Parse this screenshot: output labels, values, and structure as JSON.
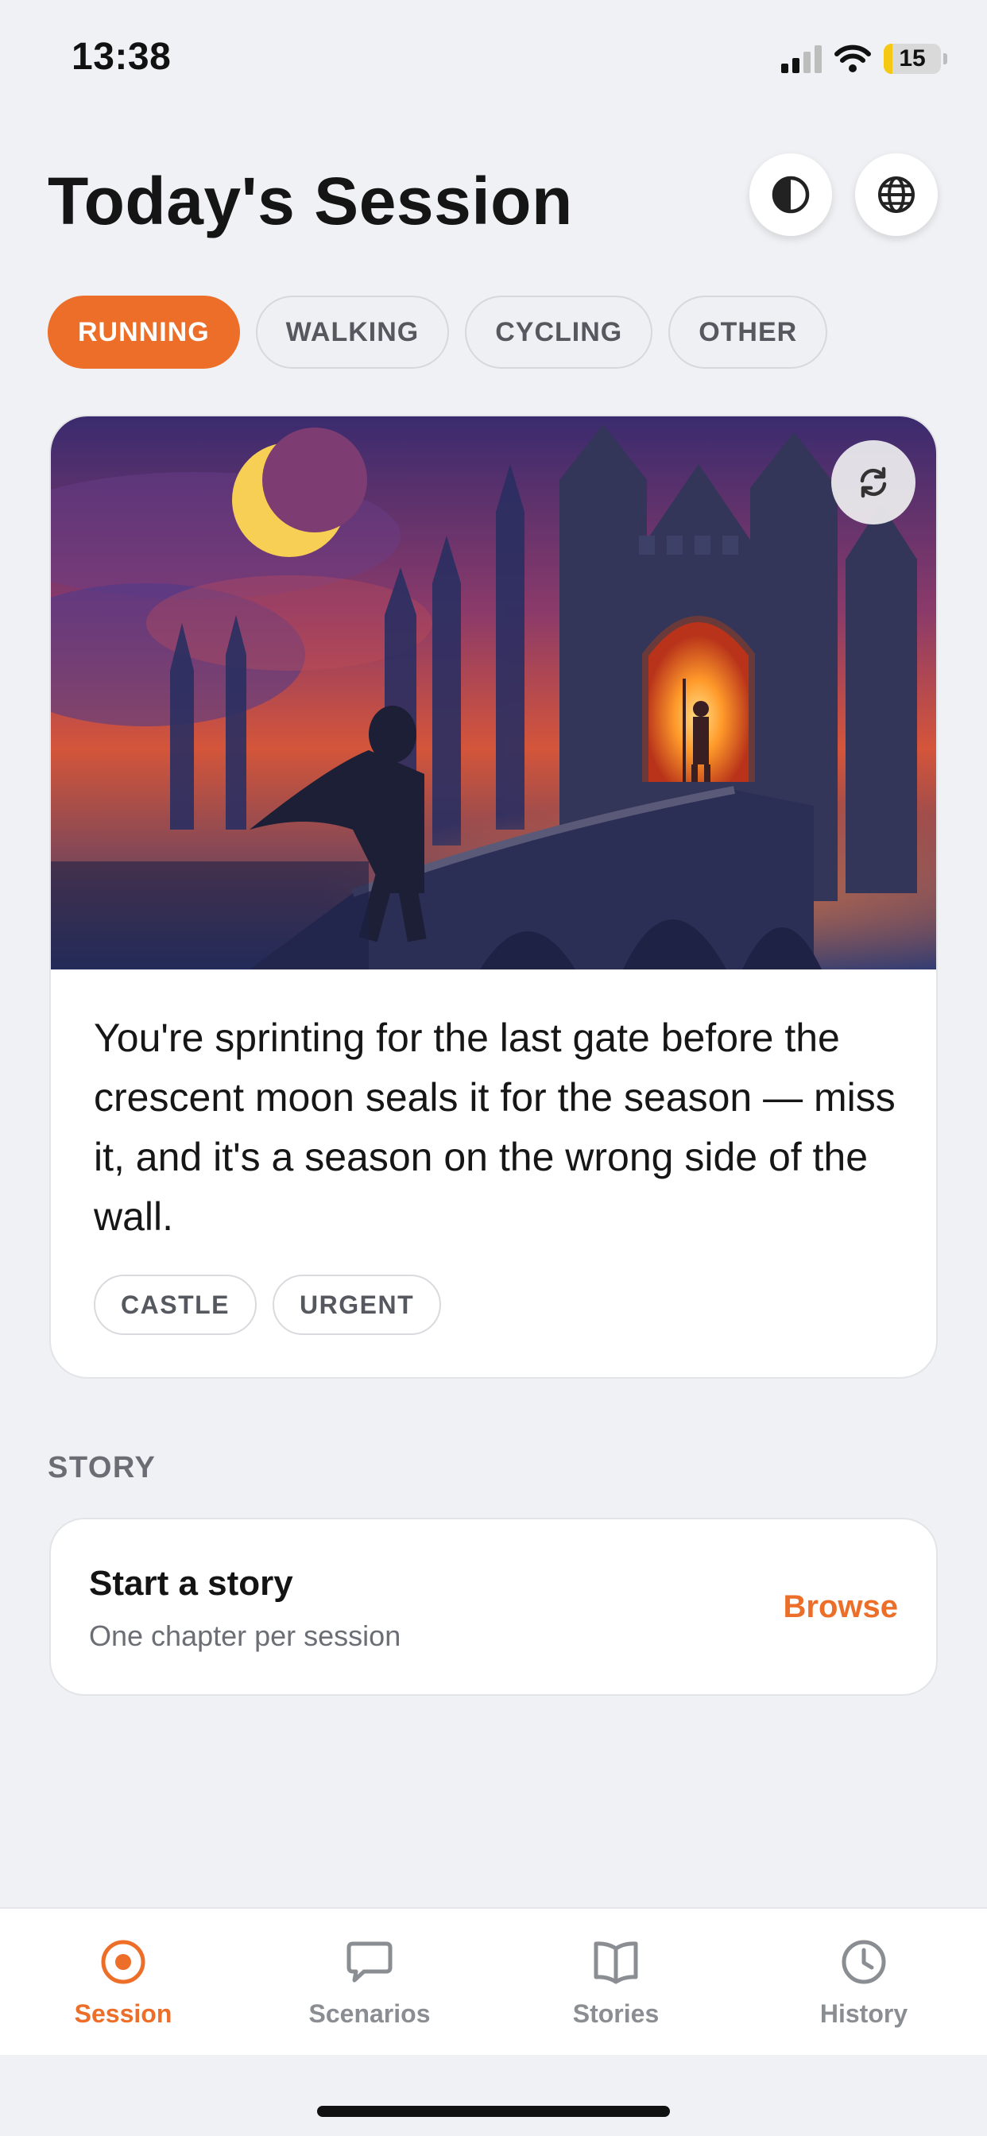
{
  "status_bar": {
    "time": "13:38",
    "battery": "15",
    "battery_level": 0.15,
    "icons": [
      "signal-icon",
      "wifi-icon",
      "battery-icon"
    ]
  },
  "header": {
    "title": "Today's Session",
    "buttons": [
      "contrast-icon",
      "globe-icon"
    ]
  },
  "activities": [
    {
      "label": "RUNNING",
      "active": true
    },
    {
      "label": "WALKING",
      "active": false
    },
    {
      "label": "CYCLING",
      "active": false
    },
    {
      "label": "OTHER",
      "active": false
    }
  ],
  "scenario": {
    "image_icon": "castle-gate-illustration",
    "refresh_icon": "refresh-icon",
    "text": "You're sprinting for the last gate before the crescent moon seals it for the season — miss it, and it's a season on the wrong side of the wall.",
    "tags": [
      "CASTLE",
      "URGENT"
    ]
  },
  "story": {
    "section_label": "STORY",
    "title": "Start a story",
    "subtitle": "One chapter per session",
    "action": "Browse"
  },
  "tabs": [
    {
      "label": "Session",
      "icon": "target-icon",
      "active": true
    },
    {
      "label": "Scenarios",
      "icon": "chat-bubble-icon",
      "active": false
    },
    {
      "label": "Stories",
      "icon": "book-icon",
      "active": false
    },
    {
      "label": "History",
      "icon": "clock-icon",
      "active": false
    }
  ],
  "colors": {
    "accent": "#ec6e28",
    "background": "#f0f1f4",
    "battery_fill": "#f5c814"
  }
}
